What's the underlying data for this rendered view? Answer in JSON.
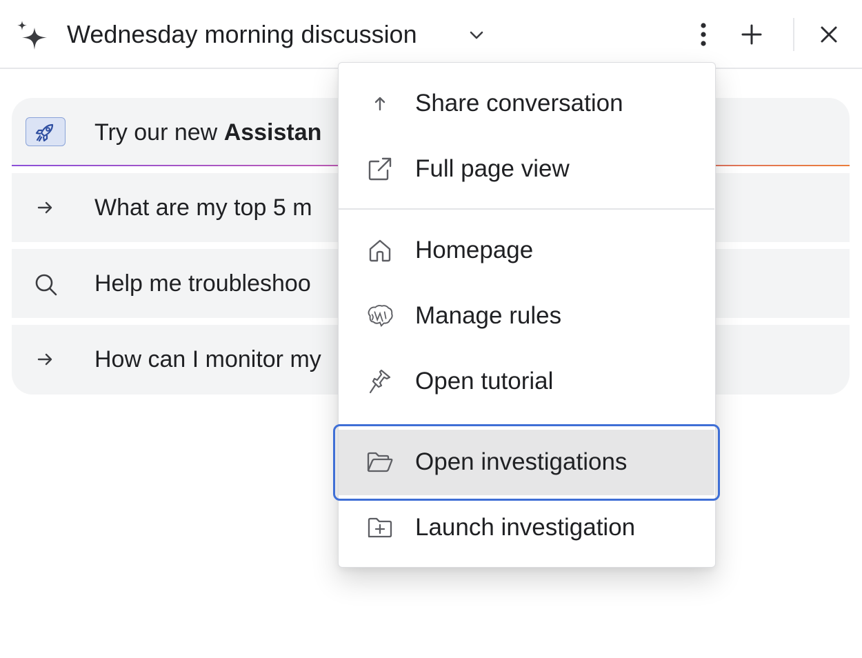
{
  "header": {
    "title": "Wednesday morning discussion",
    "icons": {
      "sparkle": "sparkle-icon",
      "chevron": "chevron-down-icon",
      "more": "more-vertical-icon",
      "add": "plus-icon",
      "close": "close-icon"
    }
  },
  "suggestions": {
    "promo": {
      "prefix": "Try our new ",
      "strong": "Assistan",
      "icon": "rocket-icon"
    },
    "items": [
      {
        "icon": "arrow-right-icon",
        "text": "What are my top 5 m"
      },
      {
        "icon": "search-icon",
        "text": "Help me troubleshoo"
      },
      {
        "icon": "arrow-right-icon",
        "text": "How can I monitor my"
      }
    ]
  },
  "menu": {
    "items": [
      {
        "label": "Share conversation",
        "icon": "arrow-up-icon"
      },
      {
        "label": "Full page view",
        "icon": "external-link-icon"
      },
      {
        "label": "Homepage",
        "icon": "home-icon"
      },
      {
        "label": "Manage rules",
        "icon": "brain-icon"
      },
      {
        "label": "Open tutorial",
        "icon": "pin-icon"
      },
      {
        "label": "Open investigations",
        "icon": "folder-open-icon",
        "active": true
      },
      {
        "label": "Launch investigation",
        "icon": "folder-plus-icon"
      }
    ]
  },
  "colors": {
    "focus_ring": "#3f6fd6",
    "promo_gradient": [
      "#8b4fd8",
      "#ea7d3a"
    ],
    "panel_bg": "#f3f4f5"
  }
}
